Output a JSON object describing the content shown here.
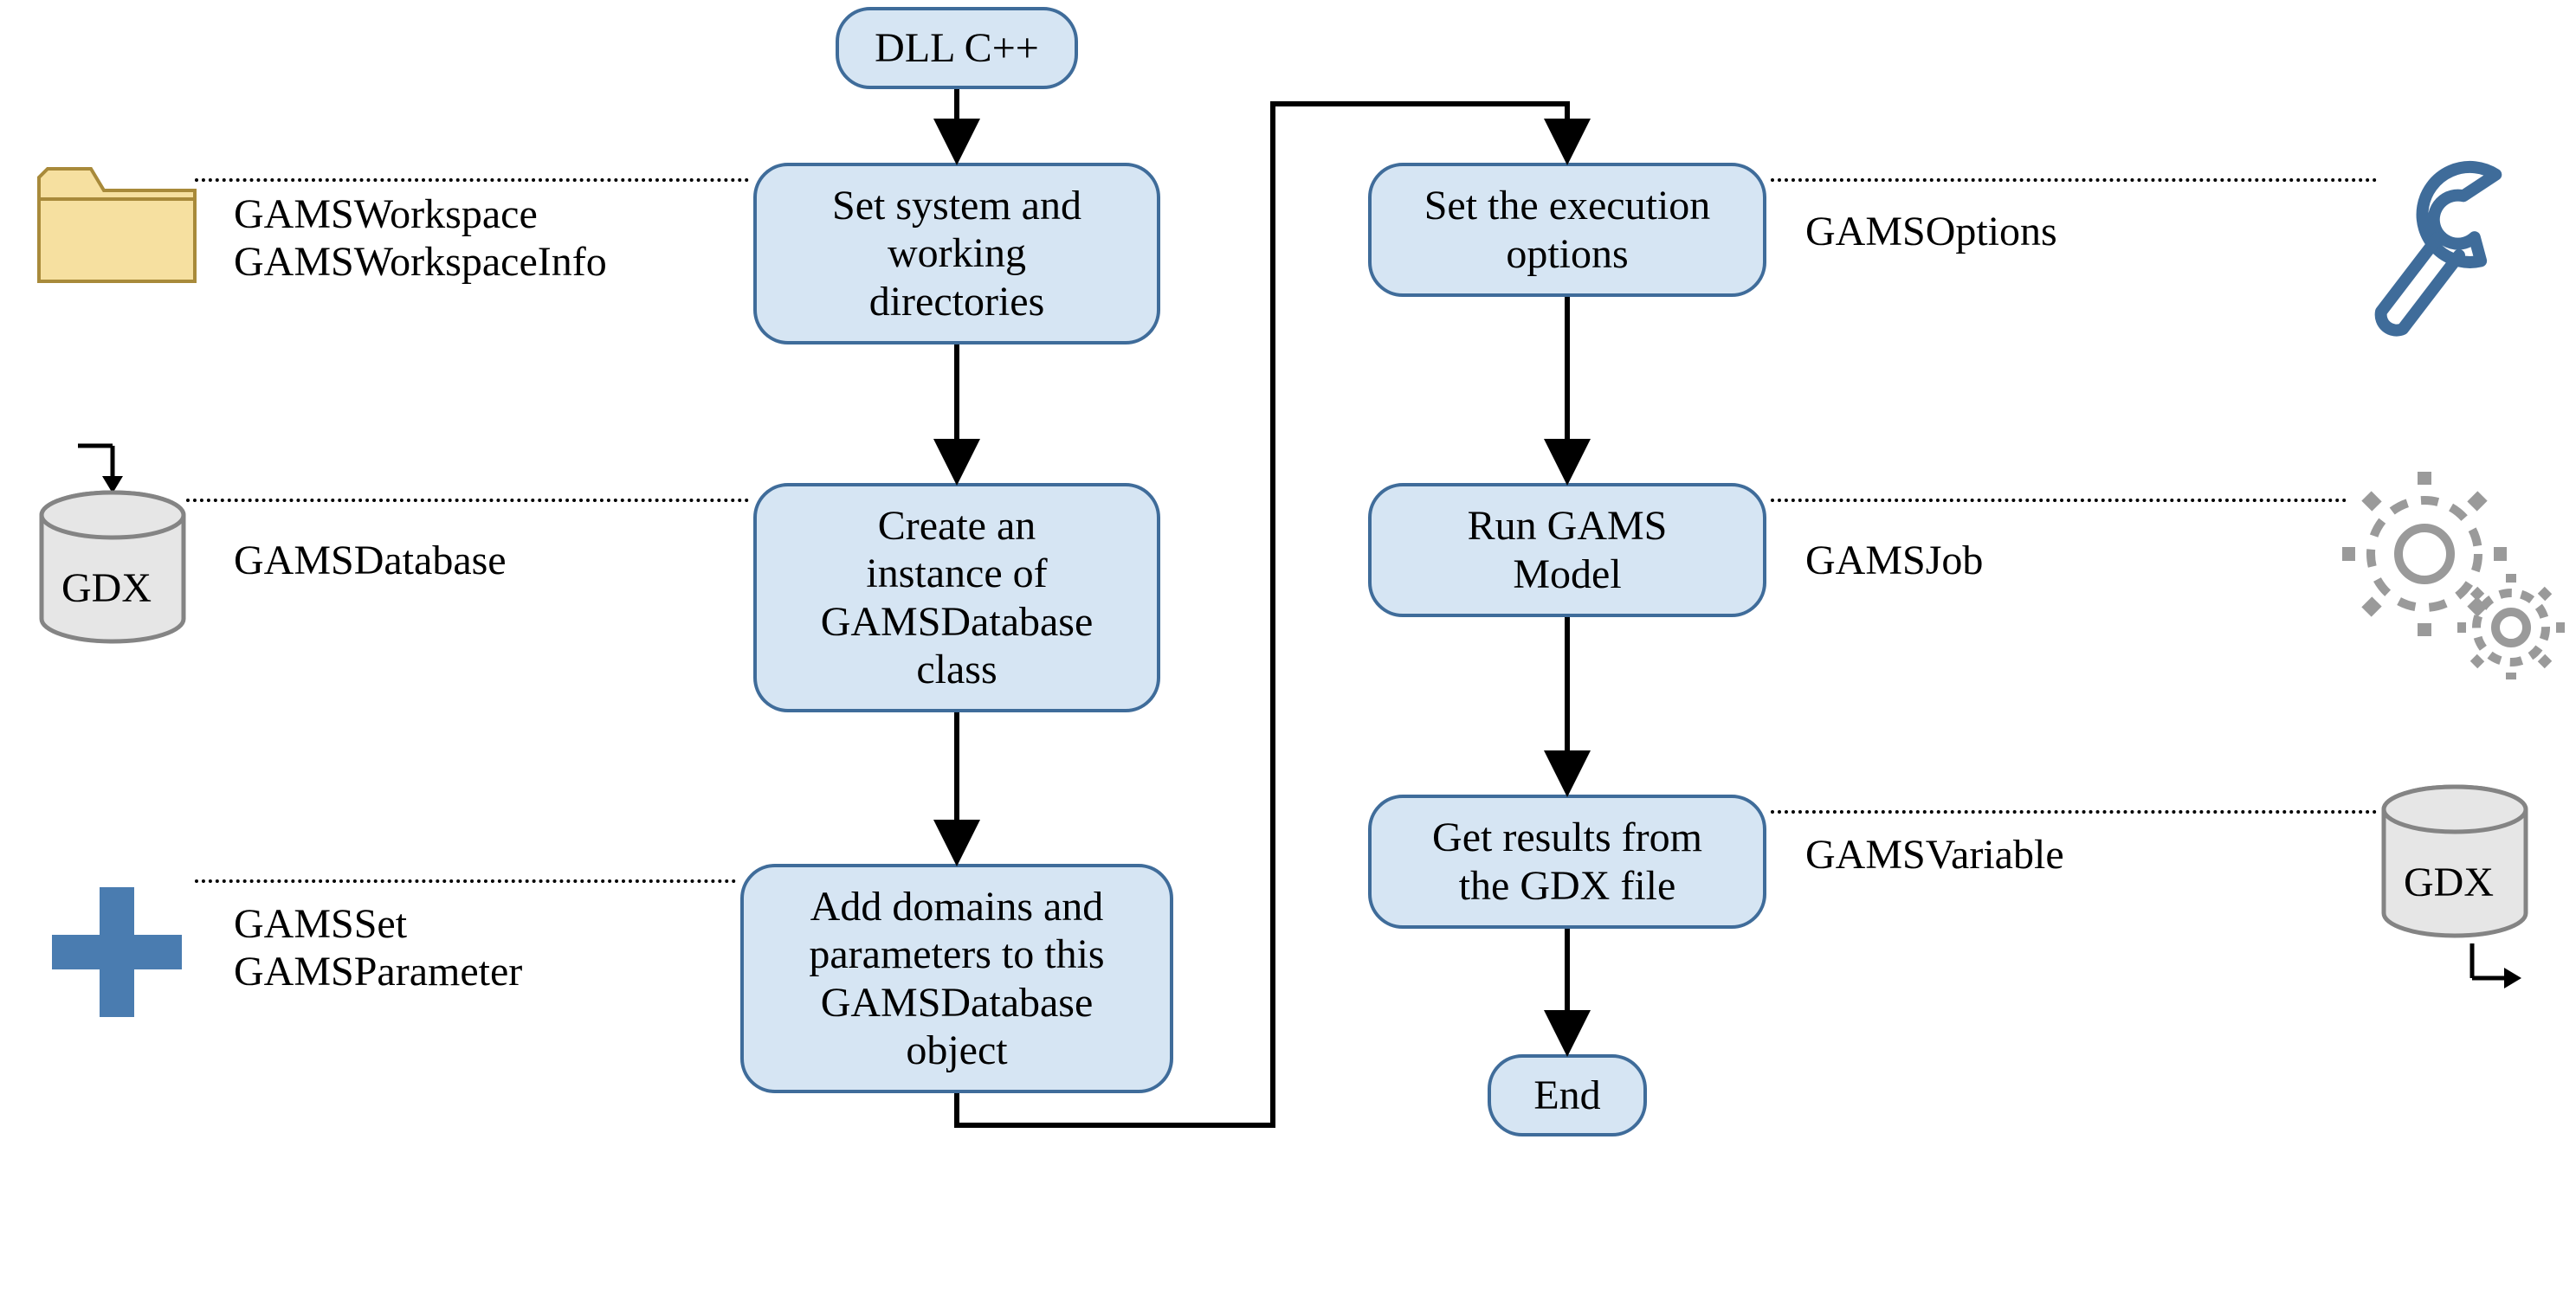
{
  "nodes": {
    "start": "DLL C++",
    "set_dirs": "Set system and\nworking\ndirectories",
    "create_db": "Create an\ninstance of\nGAMSDatabase\nclass",
    "add_domains": "Add domains and\nparameters to this\nGAMSDatabase\nobject",
    "set_options": "Set the execution\noptions",
    "run_model": "Run GAMS\nModel",
    "get_results": "Get results from\nthe GDX file",
    "end": "End"
  },
  "labels": {
    "workspace": "GAMSWorkspace\nGAMSWorkspaceInfo",
    "database": "GAMSDatabase",
    "set_param": "GAMSSet\nGAMSParameter",
    "options": "GAMSOptions",
    "job": "GAMSJob",
    "variable": "GAMSVariable"
  },
  "icons": {
    "gdx_in": "GDX",
    "gdx_out": "GDX"
  }
}
